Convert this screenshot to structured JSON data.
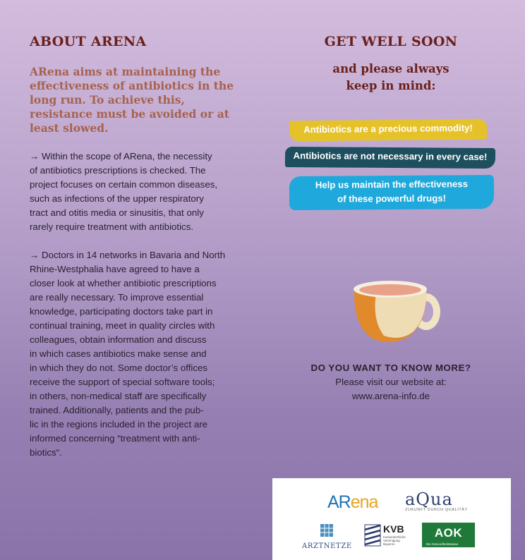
{
  "left": {
    "heading": "ABOUT ARENA",
    "lead": "ARena aims at maintaining the effectiveness of antibiotics in the long run. To achieve this, resistance must be avoided or at least slowed.",
    "para1": "→ Within the scope of ARena, the necessity\nof antibiotics prescriptions is checked. The\nproject focuses on certain common diseases,\nsuch as infections of the upper respiratory\ntract and otitis media or sinusitis, that only\nrarely require treatment with antibiotics.",
    "para2": "→ Doctors in 14 networks in Bavaria and North\nRhine-Westphalia have agreed to have a\ncloser look at whether antibiotic prescriptions\nare really necessary. To improve essential\nknowledge, participating doctors take part in\ncontinual training, meet in quality circles with\ncolleagues, obtain information and discuss\nin which cases antibiotics make sense and\nin which they do not. Some doctor’s offices\nreceive the support of special software tools;\nin others, non-medical staff are specifically\ntrained. Additionally, patients and the pub-\nlic in the regions included in the project are\ninformed concerning “treatment with anti-\nbiotics“."
  },
  "right": {
    "heading": "GET WELL SOON",
    "subheading": "and please always\nkeep in mind:",
    "banners": [
      "Antibiotics are a precious commodity!",
      "Antibiotics are not necessary in every case!",
      "Help us maintain the effectiveness\nof these powerful drugs!"
    ],
    "banner_colors": [
      "#e6c22a",
      "#1d4f5f",
      "#1fa8dc"
    ],
    "more_question": "DO YOU WANT TO KNOW MORE?",
    "more_text": "Please visit our website at:",
    "website": "www.arena-info.de",
    "icon": "tea-cup-illustration"
  },
  "logos": {
    "arena_a": "AR",
    "arena_b": "ena",
    "aqua": "aQua",
    "aqua_tagline": "ZUKUNFT DURCH QUALITÄT",
    "aerzte": "ARZTNETZE",
    "kvb": "KVB",
    "kvb_sub": "Kassenärztliche Vereinigung Bayerns",
    "aok": "AOK",
    "aok_sub": "Die Gesundheitskasse."
  }
}
